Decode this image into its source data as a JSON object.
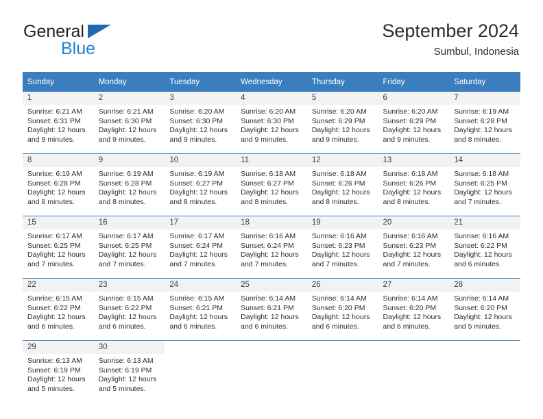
{
  "brand": {
    "name_part1": "General",
    "name_part2": "Blue",
    "logo_icon": "blue-triangle-flag-icon"
  },
  "header": {
    "title": "September 2024",
    "subtitle": "Sumbul, Indonesia"
  },
  "colors": {
    "header_blue": "#3a7ebf",
    "brand_blue": "#1f7fd4",
    "day_band_gray": "#f2f2f2",
    "text_dark": "#2d2d2d"
  },
  "weekday_headers": [
    "Sunday",
    "Monday",
    "Tuesday",
    "Wednesday",
    "Thursday",
    "Friday",
    "Saturday"
  ],
  "weeks": [
    [
      {
        "day": "1",
        "sunrise": "Sunrise: 6:21 AM",
        "sunset": "Sunset: 6:31 PM",
        "daylight1": "Daylight: 12 hours",
        "daylight2": "and 9 minutes."
      },
      {
        "day": "2",
        "sunrise": "Sunrise: 6:21 AM",
        "sunset": "Sunset: 6:30 PM",
        "daylight1": "Daylight: 12 hours",
        "daylight2": "and 9 minutes."
      },
      {
        "day": "3",
        "sunrise": "Sunrise: 6:20 AM",
        "sunset": "Sunset: 6:30 PM",
        "daylight1": "Daylight: 12 hours",
        "daylight2": "and 9 minutes."
      },
      {
        "day": "4",
        "sunrise": "Sunrise: 6:20 AM",
        "sunset": "Sunset: 6:30 PM",
        "daylight1": "Daylight: 12 hours",
        "daylight2": "and 9 minutes."
      },
      {
        "day": "5",
        "sunrise": "Sunrise: 6:20 AM",
        "sunset": "Sunset: 6:29 PM",
        "daylight1": "Daylight: 12 hours",
        "daylight2": "and 9 minutes."
      },
      {
        "day": "6",
        "sunrise": "Sunrise: 6:20 AM",
        "sunset": "Sunset: 6:29 PM",
        "daylight1": "Daylight: 12 hours",
        "daylight2": "and 9 minutes."
      },
      {
        "day": "7",
        "sunrise": "Sunrise: 6:19 AM",
        "sunset": "Sunset: 6:28 PM",
        "daylight1": "Daylight: 12 hours",
        "daylight2": "and 8 minutes."
      }
    ],
    [
      {
        "day": "8",
        "sunrise": "Sunrise: 6:19 AM",
        "sunset": "Sunset: 6:28 PM",
        "daylight1": "Daylight: 12 hours",
        "daylight2": "and 8 minutes."
      },
      {
        "day": "9",
        "sunrise": "Sunrise: 6:19 AM",
        "sunset": "Sunset: 6:28 PM",
        "daylight1": "Daylight: 12 hours",
        "daylight2": "and 8 minutes."
      },
      {
        "day": "10",
        "sunrise": "Sunrise: 6:19 AM",
        "sunset": "Sunset: 6:27 PM",
        "daylight1": "Daylight: 12 hours",
        "daylight2": "and 8 minutes."
      },
      {
        "day": "11",
        "sunrise": "Sunrise: 6:18 AM",
        "sunset": "Sunset: 6:27 PM",
        "daylight1": "Daylight: 12 hours",
        "daylight2": "and 8 minutes."
      },
      {
        "day": "12",
        "sunrise": "Sunrise: 6:18 AM",
        "sunset": "Sunset: 6:26 PM",
        "daylight1": "Daylight: 12 hours",
        "daylight2": "and 8 minutes."
      },
      {
        "day": "13",
        "sunrise": "Sunrise: 6:18 AM",
        "sunset": "Sunset: 6:26 PM",
        "daylight1": "Daylight: 12 hours",
        "daylight2": "and 8 minutes."
      },
      {
        "day": "14",
        "sunrise": "Sunrise: 6:18 AM",
        "sunset": "Sunset: 6:25 PM",
        "daylight1": "Daylight: 12 hours",
        "daylight2": "and 7 minutes."
      }
    ],
    [
      {
        "day": "15",
        "sunrise": "Sunrise: 6:17 AM",
        "sunset": "Sunset: 6:25 PM",
        "daylight1": "Daylight: 12 hours",
        "daylight2": "and 7 minutes."
      },
      {
        "day": "16",
        "sunrise": "Sunrise: 6:17 AM",
        "sunset": "Sunset: 6:25 PM",
        "daylight1": "Daylight: 12 hours",
        "daylight2": "and 7 minutes."
      },
      {
        "day": "17",
        "sunrise": "Sunrise: 6:17 AM",
        "sunset": "Sunset: 6:24 PM",
        "daylight1": "Daylight: 12 hours",
        "daylight2": "and 7 minutes."
      },
      {
        "day": "18",
        "sunrise": "Sunrise: 6:16 AM",
        "sunset": "Sunset: 6:24 PM",
        "daylight1": "Daylight: 12 hours",
        "daylight2": "and 7 minutes."
      },
      {
        "day": "19",
        "sunrise": "Sunrise: 6:16 AM",
        "sunset": "Sunset: 6:23 PM",
        "daylight1": "Daylight: 12 hours",
        "daylight2": "and 7 minutes."
      },
      {
        "day": "20",
        "sunrise": "Sunrise: 6:16 AM",
        "sunset": "Sunset: 6:23 PM",
        "daylight1": "Daylight: 12 hours",
        "daylight2": "and 7 minutes."
      },
      {
        "day": "21",
        "sunrise": "Sunrise: 6:16 AM",
        "sunset": "Sunset: 6:22 PM",
        "daylight1": "Daylight: 12 hours",
        "daylight2": "and 6 minutes."
      }
    ],
    [
      {
        "day": "22",
        "sunrise": "Sunrise: 6:15 AM",
        "sunset": "Sunset: 6:22 PM",
        "daylight1": "Daylight: 12 hours",
        "daylight2": "and 6 minutes."
      },
      {
        "day": "23",
        "sunrise": "Sunrise: 6:15 AM",
        "sunset": "Sunset: 6:22 PM",
        "daylight1": "Daylight: 12 hours",
        "daylight2": "and 6 minutes."
      },
      {
        "day": "24",
        "sunrise": "Sunrise: 6:15 AM",
        "sunset": "Sunset: 6:21 PM",
        "daylight1": "Daylight: 12 hours",
        "daylight2": "and 6 minutes."
      },
      {
        "day": "25",
        "sunrise": "Sunrise: 6:14 AM",
        "sunset": "Sunset: 6:21 PM",
        "daylight1": "Daylight: 12 hours",
        "daylight2": "and 6 minutes."
      },
      {
        "day": "26",
        "sunrise": "Sunrise: 6:14 AM",
        "sunset": "Sunset: 6:20 PM",
        "daylight1": "Daylight: 12 hours",
        "daylight2": "and 6 minutes."
      },
      {
        "day": "27",
        "sunrise": "Sunrise: 6:14 AM",
        "sunset": "Sunset: 6:20 PM",
        "daylight1": "Daylight: 12 hours",
        "daylight2": "and 6 minutes."
      },
      {
        "day": "28",
        "sunrise": "Sunrise: 6:14 AM",
        "sunset": "Sunset: 6:20 PM",
        "daylight1": "Daylight: 12 hours",
        "daylight2": "and 5 minutes."
      }
    ],
    [
      {
        "day": "29",
        "sunrise": "Sunrise: 6:13 AM",
        "sunset": "Sunset: 6:19 PM",
        "daylight1": "Daylight: 12 hours",
        "daylight2": "and 5 minutes."
      },
      {
        "day": "30",
        "sunrise": "Sunrise: 6:13 AM",
        "sunset": "Sunset: 6:19 PM",
        "daylight1": "Daylight: 12 hours",
        "daylight2": "and 5 minutes."
      },
      {
        "day": "",
        "sunrise": "",
        "sunset": "",
        "daylight1": "",
        "daylight2": ""
      },
      {
        "day": "",
        "sunrise": "",
        "sunset": "",
        "daylight1": "",
        "daylight2": ""
      },
      {
        "day": "",
        "sunrise": "",
        "sunset": "",
        "daylight1": "",
        "daylight2": ""
      },
      {
        "day": "",
        "sunrise": "",
        "sunset": "",
        "daylight1": "",
        "daylight2": ""
      },
      {
        "day": "",
        "sunrise": "",
        "sunset": "",
        "daylight1": "",
        "daylight2": ""
      }
    ]
  ]
}
